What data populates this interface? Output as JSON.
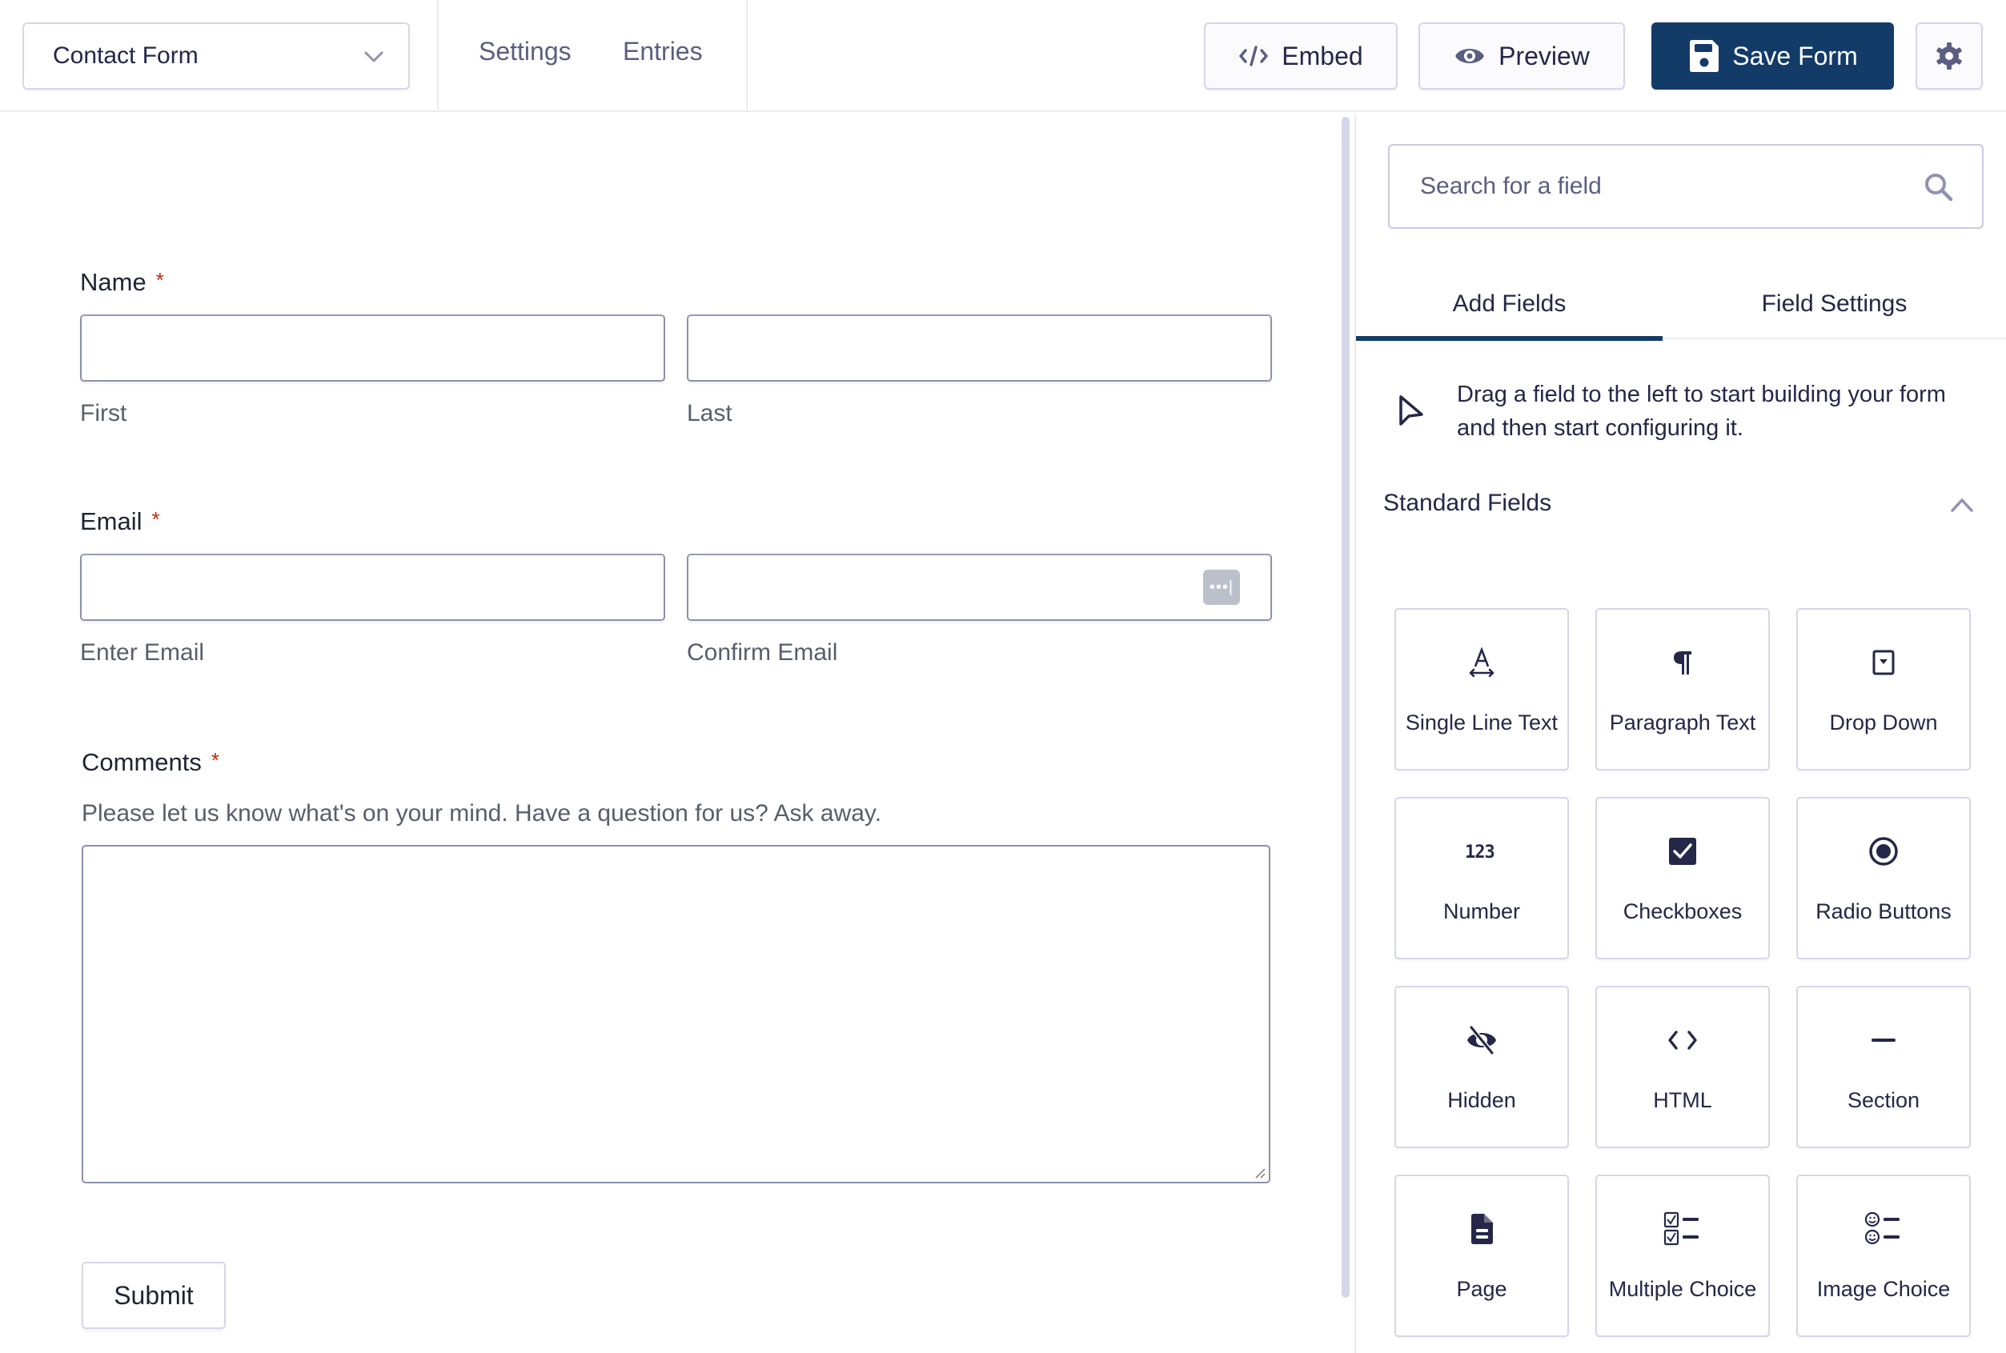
{
  "topbar": {
    "form_selector": {
      "value": "Contact Form",
      "icon": "chevron-down-icon"
    },
    "nav": [
      {
        "label": "Settings"
      },
      {
        "label": "Entries"
      }
    ],
    "buttons": {
      "embed": {
        "label": "Embed",
        "icon": "code-icon"
      },
      "preview": {
        "label": "Preview",
        "icon": "eye-icon"
      },
      "save": {
        "label": "Save Form",
        "icon": "floppy-disk-icon"
      },
      "settings": {
        "icon": "gear-icon"
      }
    },
    "colors": {
      "primary": "#133b68",
      "required": "#c02b0a"
    }
  },
  "form": {
    "name": {
      "label": "Name",
      "required_mark": "*",
      "first": {
        "value": "",
        "sublabel": "First"
      },
      "last": {
        "value": "",
        "sublabel": "Last"
      }
    },
    "email": {
      "label": "Email",
      "required_mark": "*",
      "enter": {
        "value": "",
        "sublabel": "Enter Email"
      },
      "confirm": {
        "value": "",
        "sublabel": "Confirm Email",
        "badge": "•••|"
      }
    },
    "comments": {
      "label": "Comments",
      "required_mark": "*",
      "description": "Please let us know what's on your mind. Have a question for us? Ask away.",
      "value": ""
    },
    "submit_label": "Submit"
  },
  "sidebar": {
    "search": {
      "placeholder": "Search for a field",
      "value": ""
    },
    "tabs": [
      {
        "label": "Add Fields",
        "active": true
      },
      {
        "label": "Field Settings",
        "active": false
      }
    ],
    "hint": "Drag a field to the left to start building your form and then start configuring it.",
    "section": {
      "title": "Standard Fields",
      "expanded": true
    },
    "fields": [
      {
        "label": "Single Line Text",
        "icon": "text-width-icon"
      },
      {
        "label": "Paragraph Text",
        "icon": "paragraph-icon"
      },
      {
        "label": "Drop Down",
        "icon": "dropdown-icon"
      },
      {
        "label": "Number",
        "icon": "number-icon"
      },
      {
        "label": "Checkboxes",
        "icon": "checkbox-icon"
      },
      {
        "label": "Radio Buttons",
        "icon": "radio-icon"
      },
      {
        "label": "Hidden",
        "icon": "eye-slash-icon"
      },
      {
        "label": "HTML",
        "icon": "code-brackets-icon"
      },
      {
        "label": "Section",
        "icon": "section-line-icon"
      },
      {
        "label": "Page",
        "icon": "page-icon"
      },
      {
        "label": "Multiple Choice",
        "icon": "multiple-choice-icon"
      },
      {
        "label": "Image Choice",
        "icon": "image-choice-icon"
      }
    ]
  }
}
